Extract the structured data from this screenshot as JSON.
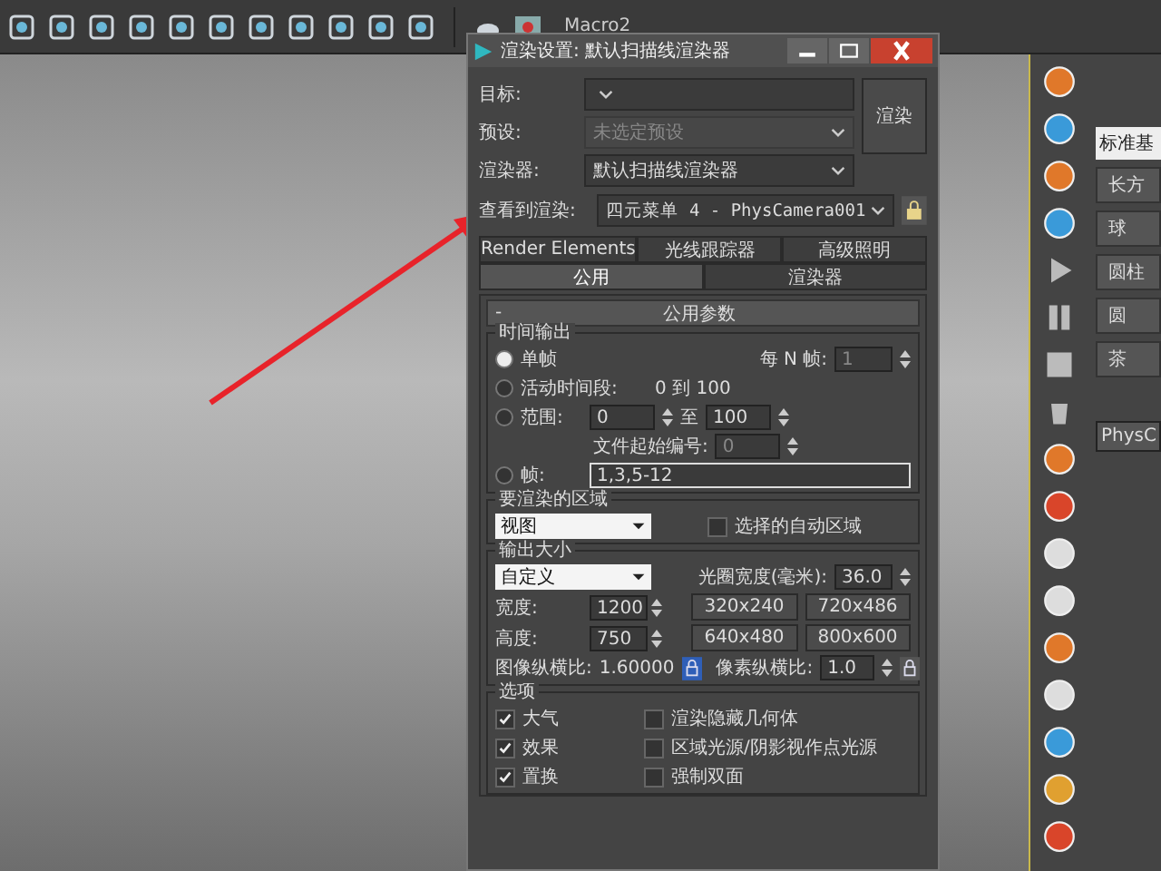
{
  "toolbar": {
    "label": "Macro2"
  },
  "dialog": {
    "title": "渲染设置: 默认扫描线渲染器",
    "fields": [
      {
        "label": "目标:",
        "disabled": false
      },
      {
        "label": "预设:",
        "value": "未选定预设",
        "disabled": true
      },
      {
        "label": "渲染器:",
        "value": "默认扫描线渲染器",
        "disabled": false
      }
    ],
    "render_button": "渲染",
    "view": {
      "label": "查看到渲染:",
      "value": "四元菜单 4 - PhysCamera001"
    },
    "tabs_row1": [
      {
        "label": "Render Elements",
        "selected": false
      },
      {
        "label": "光线跟踪器",
        "selected": false
      },
      {
        "label": "高级照明",
        "selected": false
      }
    ],
    "tabs_row2": [
      {
        "label": "公用",
        "selected": true
      },
      {
        "label": "渲染器",
        "selected": false
      }
    ],
    "rollout": {
      "collapse": "-",
      "title": "公用参数"
    },
    "time_output": {
      "title": "时间输出",
      "options": [
        {
          "label": "单帧",
          "selected": true
        },
        {
          "label": "活动时间段:",
          "selected": false
        },
        {
          "label": "范围:",
          "selected": false
        },
        {
          "label": "帧:",
          "selected": false
        }
      ],
      "every_n": {
        "label": "每 N 帧:",
        "value": "1"
      },
      "active_range": "0 到 100",
      "range_from": "0",
      "range_to_label": "至",
      "range_to": "100",
      "file_start": {
        "label": "文件起始编号:",
        "value": "0"
      },
      "frames": "1,3,5-12"
    },
    "area": {
      "title": "要渲染的区域",
      "dropdown": "视图",
      "auto_region": {
        "label": "选择的自动区域",
        "checked": false
      }
    },
    "output_size": {
      "title": "输出大小",
      "preset": "自定义",
      "aperture": {
        "label": "光圈宽度(毫米):",
        "value": "36.0"
      },
      "width": {
        "label": "宽度:",
        "value": "1200"
      },
      "height": {
        "label": "高度:",
        "value": "750"
      },
      "presets": [
        "320x240",
        "720x486",
        "640x480",
        "800x600"
      ],
      "image_aspect": {
        "label": "图像纵横比:",
        "value": "1.60000",
        "locked": true
      },
      "pixel_aspect": {
        "label": "像素纵横比:",
        "value": "1.0",
        "locked": false
      }
    },
    "options": {
      "title": "选项",
      "items": [
        {
          "label": "大气",
          "checked": true
        },
        {
          "label": "渲染隐藏几何体",
          "checked": false
        },
        {
          "label": "效果",
          "checked": true
        },
        {
          "label": "区域光源/阴影视作点光源",
          "checked": false
        },
        {
          "label": "置换",
          "checked": true
        },
        {
          "label": "强制双面",
          "checked": false
        }
      ]
    }
  },
  "command_panel": {
    "dropdown": "标准基",
    "buttons": [
      "长方",
      "球",
      "圆柱",
      "圆",
      "茶"
    ],
    "name_field": "PhysC"
  }
}
